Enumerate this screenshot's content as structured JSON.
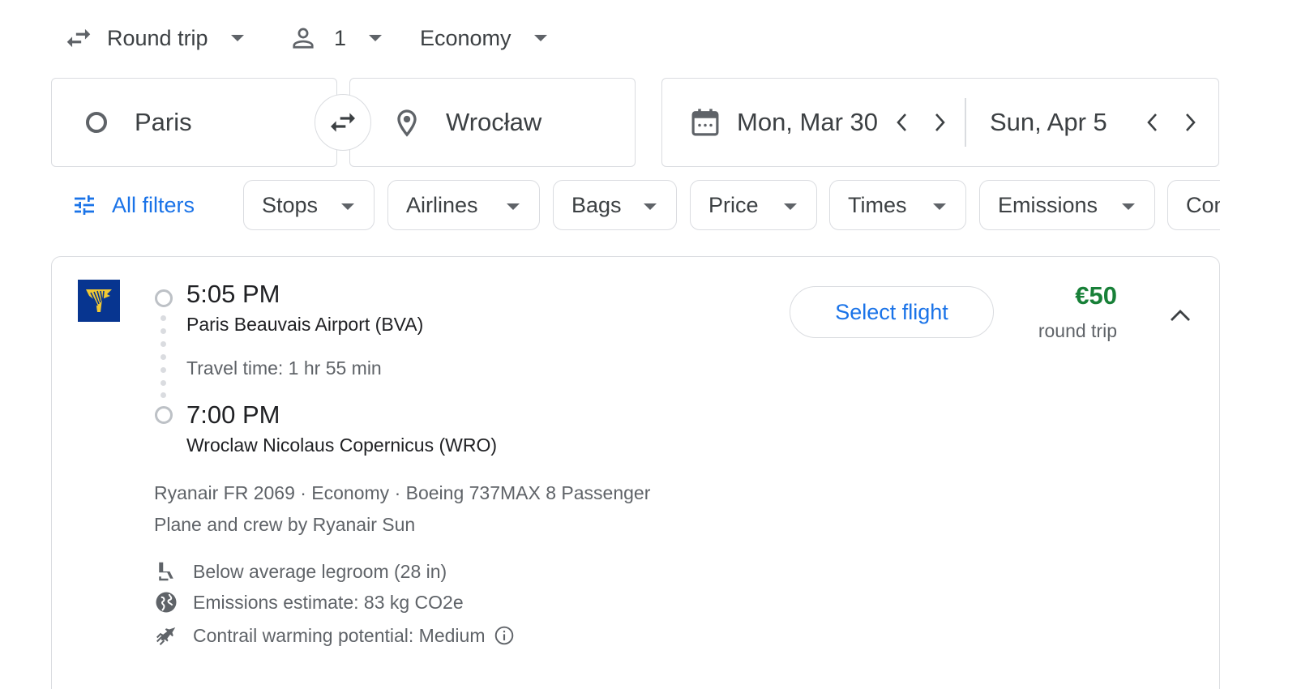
{
  "trip_options": {
    "trip_type": "Round trip",
    "passengers": "1",
    "cabin": "Economy"
  },
  "search": {
    "origin": "Paris",
    "destination": "Wrocław",
    "depart_date": "Mon, Mar 30",
    "return_date": "Sun, Apr 5"
  },
  "filters": {
    "all_filters_label": "All filters",
    "chips": [
      "Stops",
      "Airlines",
      "Bags",
      "Price",
      "Times",
      "Emissions",
      "Connecting airports"
    ]
  },
  "flight": {
    "airline_logo": "ryanair-logo",
    "depart_time": "5:05 PM",
    "depart_airport": "Paris Beauvais Airport (BVA)",
    "travel_time": "Travel time: 1 hr 55 min",
    "arrive_time": "7:00 PM",
    "arrive_airport": "Wroclaw Nicolaus Copernicus (WRO)",
    "details": "Ryanair FR 2069 · Economy · Boeing 737MAX 8 Passenger",
    "operated_by": "Plane and crew by Ryanair Sun",
    "amenities": [
      {
        "icon": "legroom-seat-icon",
        "text": "Below average legroom (28 in)"
      },
      {
        "icon": "globe-icon",
        "text": "Emissions estimate: 83 kg CO2e"
      },
      {
        "icon": "contrail-plane-icon",
        "text": "Contrail warming potential: Medium"
      }
    ],
    "select_label": "Select flight",
    "price": "€50",
    "price_note": "round trip"
  },
  "colors": {
    "accent_blue": "#1a73e8",
    "price_green": "#188038",
    "ryanair_blue": "#073590",
    "ryanair_yellow": "#f1c933",
    "border": "#dadce0"
  }
}
